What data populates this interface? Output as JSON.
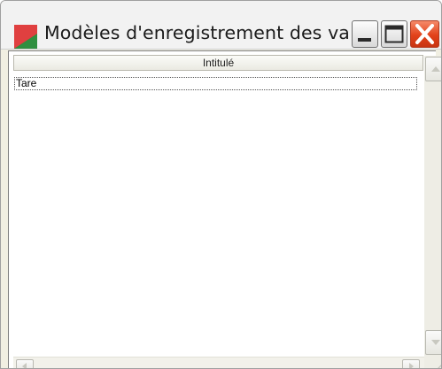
{
  "window": {
    "title": "Modèles d'enregistrement des va...",
    "app_icon": "app-flag-icon",
    "controls": {
      "minimize_icon": "minimize-icon",
      "maximize_icon": "maximize-icon",
      "close_icon": "close-icon"
    }
  },
  "list": {
    "columns": [
      "Intitulé"
    ],
    "rows": [
      {
        "label": "Tare"
      }
    ]
  },
  "colors": {
    "close_button": "#e2421a",
    "icon_red": "#d6262a",
    "icon_green": "#2f8f3f"
  }
}
